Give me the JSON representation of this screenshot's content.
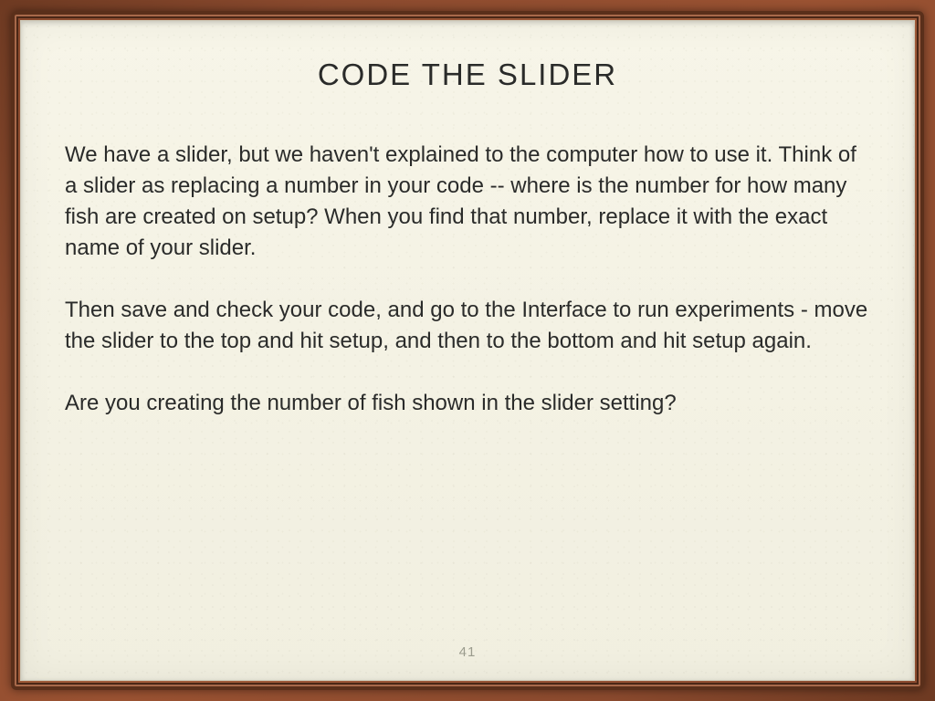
{
  "slide": {
    "title": "CODE THE SLIDER",
    "paragraphs": [
      "We have a slider, but we haven't explained to the computer how to use it.  Think of a slider as replacing a number in your code -- where is the number for how many fish are created on setup?  When you find that number, replace it with the exact name of your slider.",
      "Then save and check your code, and go to the Interface to run experiments - move the slider to the top and hit setup, and then to the bottom and hit setup again.",
      "Are you creating the number of fish shown in the slider setting?"
    ],
    "page_number": "41"
  }
}
